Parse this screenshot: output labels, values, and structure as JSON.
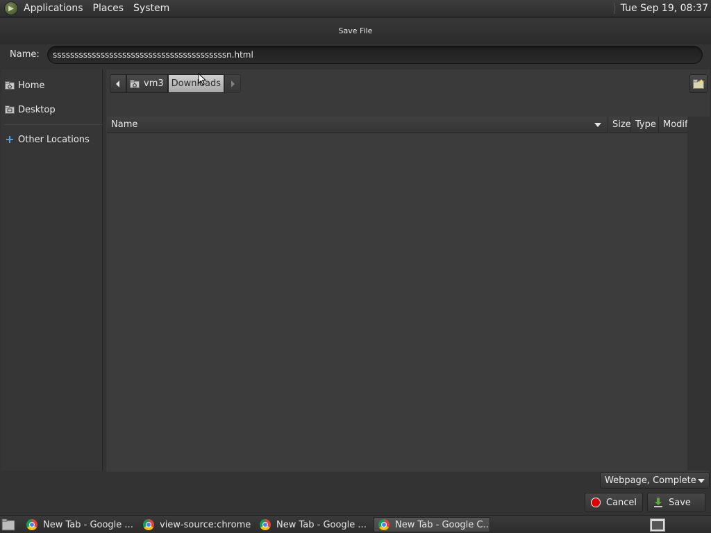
{
  "top_panel": {
    "menus": [
      "Applications",
      "Places",
      "System"
    ],
    "clock": "Tue Sep 19, 08:37"
  },
  "dialog": {
    "title": "Save File",
    "name_label": "Name:",
    "name_value": "ssssssssssssssssssssssssssssssssssssssssn.html",
    "sidebar": {
      "items": [
        {
          "label": "Home",
          "icon": "home-folder-icon"
        },
        {
          "label": "Desktop",
          "icon": "desktop-folder-icon"
        },
        {
          "label": "Other Locations",
          "icon": "plus-icon"
        }
      ]
    },
    "path": {
      "segments": [
        "vm3",
        "Downloads"
      ],
      "current": "Downloads"
    },
    "columns": [
      "Name",
      "Size",
      "Type",
      "Modif"
    ],
    "filter": "Webpage, Complete",
    "cancel_label": "Cancel",
    "save_label": "Save"
  },
  "taskbar": {
    "tasks": [
      {
        "label": "New Tab - Google ..."
      },
      {
        "label": "view-source:chrome..."
      },
      {
        "label": "New Tab - Google ..."
      },
      {
        "label": "New Tab - Google C..."
      }
    ],
    "active_task": 3
  },
  "colors": {
    "accent_cancel": "#e00000",
    "accent_save": "#5aa83a",
    "chrome_blue": "#4285f4"
  }
}
